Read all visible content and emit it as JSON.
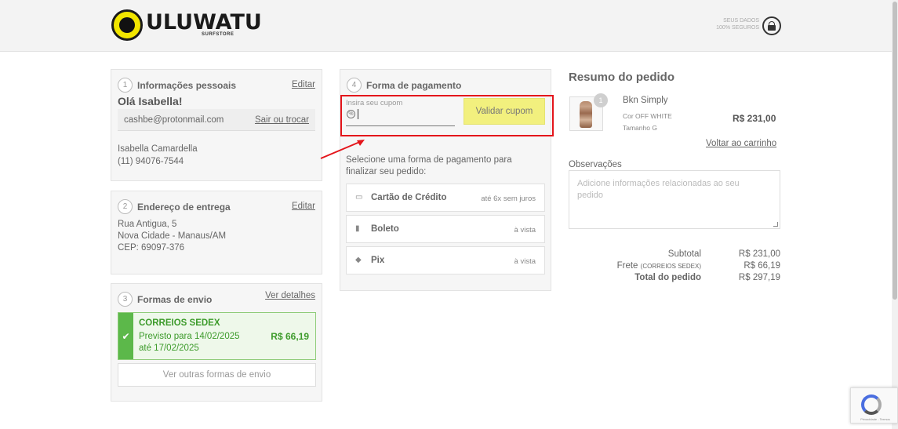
{
  "header": {
    "brand": "ULUWATU",
    "brand_sub": "SURFSTORE",
    "secure_line1": "SEUS DADOS",
    "secure_line2": "100% SEGUROS"
  },
  "personal": {
    "step": "1",
    "title": "Informações pessoais",
    "edit": "Editar",
    "greeting": "Olá Isabella!",
    "email": "cashbe@protonmail.com",
    "switch": "Sair ou trocar",
    "name": "Isabella Camardella",
    "phone": "(11) 94076-7544"
  },
  "address": {
    "step": "2",
    "title": "Endereço de entrega",
    "edit": "Editar",
    "line1": "Rua Antigua, 5",
    "line2": "Nova Cidade - Manaus/AM",
    "line3": "CEP: 69097-376"
  },
  "shipping": {
    "step": "3",
    "title": "Formas de envio",
    "details": "Ver detalhes",
    "option_name": "CORREIOS SEDEX",
    "option_date1": "Previsto para 14/02/2025",
    "option_date2": "até 17/02/2025",
    "option_price": "R$ 66,19",
    "other": "Ver outras formas de envio"
  },
  "payment": {
    "step": "4",
    "title": "Forma de pagamento",
    "coupon_label": "Insira seu cupom",
    "coupon_value": "",
    "coupon_button": "Validar cupom",
    "instruction": "Selecione uma forma de pagamento para finalizar seu pedido:",
    "options": [
      {
        "icon": "credit-card-icon",
        "name": "Cartão de Crédito",
        "info": "até 6x sem juros"
      },
      {
        "icon": "barcode-icon",
        "name": "Boleto",
        "info": "à vista"
      },
      {
        "icon": "pix-icon",
        "name": "Pix",
        "info": "à vista"
      }
    ]
  },
  "summary": {
    "title": "Resumo do pedido",
    "product": {
      "qty": "1",
      "name": "Bkn Simply",
      "color": "Cor OFF WHITE",
      "size": "Tamanho G",
      "price": "R$ 231,00"
    },
    "back_to_cart": "Voltar ao carrinho",
    "notes_label": "Observações",
    "notes_placeholder": "Adicione informações relacionadas ao seu pedido",
    "subtotal_label": "Subtotal",
    "subtotal_value": "R$ 231,00",
    "shipping_label": "Frete",
    "shipping_method": "(CORREIOS SEDEX)",
    "shipping_value": "R$ 66,19",
    "total_label": "Total do pedido",
    "total_value": "R$ 297,19"
  },
  "recaptcha": {
    "text": "Privacidade - Termos"
  },
  "colors": {
    "highlight_border": "#e4151b",
    "coupon_button": "#f2f07e",
    "shipping_selected": "#5cb84a",
    "brand_yellow": "#f2e600"
  }
}
